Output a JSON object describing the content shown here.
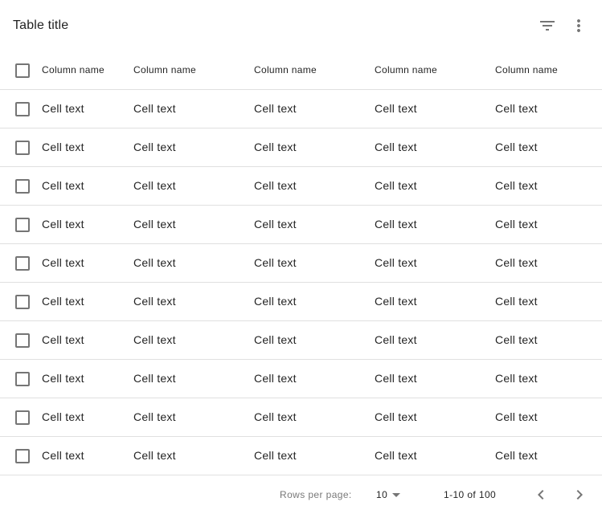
{
  "header": {
    "title": "Table title",
    "filter_icon": "filter-list-icon",
    "more_icon": "more-vert-icon"
  },
  "table": {
    "columns": [
      "Column name",
      "Column name",
      "Column name",
      "Column name",
      "Column name"
    ],
    "rows": [
      [
        "Cell text",
        "Cell text",
        "Cell text",
        "Cell text",
        "Cell text"
      ],
      [
        "Cell text",
        "Cell text",
        "Cell text",
        "Cell text",
        "Cell text"
      ],
      [
        "Cell text",
        "Cell text",
        "Cell text",
        "Cell text",
        "Cell text"
      ],
      [
        "Cell text",
        "Cell text",
        "Cell text",
        "Cell text",
        "Cell text"
      ],
      [
        "Cell text",
        "Cell text",
        "Cell text",
        "Cell text",
        "Cell text"
      ],
      [
        "Cell text",
        "Cell text",
        "Cell text",
        "Cell text",
        "Cell text"
      ],
      [
        "Cell text",
        "Cell text",
        "Cell text",
        "Cell text",
        "Cell text"
      ],
      [
        "Cell text",
        "Cell text",
        "Cell text",
        "Cell text",
        "Cell text"
      ],
      [
        "Cell text",
        "Cell text",
        "Cell text",
        "Cell text",
        "Cell text"
      ],
      [
        "Cell text",
        "Cell text",
        "Cell text",
        "Cell text",
        "Cell text"
      ]
    ]
  },
  "pagination": {
    "rows_per_page_label": "Rows per page:",
    "rows_per_page_value": "10",
    "range": "1-10 of 100",
    "prev_icon": "chevron-left-icon",
    "next_icon": "chevron-right-icon"
  }
}
